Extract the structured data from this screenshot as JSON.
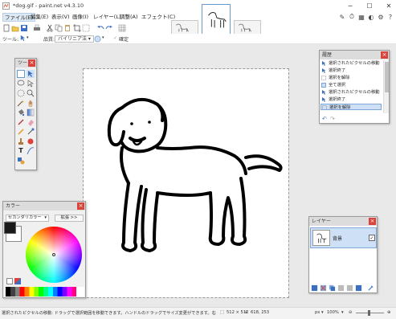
{
  "window": {
    "title": "*dog.gif - paint.net v4.3.10",
    "minimize": "─",
    "maximize": "☐",
    "close": "✕"
  },
  "menu": {
    "items": [
      "ファイル(E)",
      "編集(E)",
      "表示(V)",
      "画像(I)",
      "レイヤー(L)",
      "調整(A)",
      "エフェクト(C)"
    ]
  },
  "toolbar": {
    "tool_label": "ツール:",
    "quality_label": "品質:",
    "quality_value": "バイリニア法",
    "confirm_label": "確定"
  },
  "tools_panel": {
    "title": "ツー"
  },
  "history_panel": {
    "title": "履歴",
    "items": [
      "選択されたピクセルの移動",
      "選択終了",
      "選択を解除",
      "全て選択",
      "選択されたピクセルの移動",
      "選択終了",
      "選択を解除"
    ],
    "selected_index": 6
  },
  "colors_panel": {
    "title": "カラー",
    "mode_value": "セカンダリカラー",
    "expand_label": "拡張 >>"
  },
  "layers_panel": {
    "title": "レイヤー",
    "layer_name": "背景"
  },
  "status": {
    "hint": "選択されたピクセルの移動: ドラッグで選択範囲を移動できます。ハンドルのドラッグでサイズ変更ができます。右ドラッグで回転ができます。",
    "size": "512 × 512",
    "position": "618, 253",
    "unit": "px",
    "zoom": "100%"
  },
  "colors": {
    "accent": "#6b9ad1",
    "close_red": "#d9433b",
    "selection": "#cde0f5"
  }
}
